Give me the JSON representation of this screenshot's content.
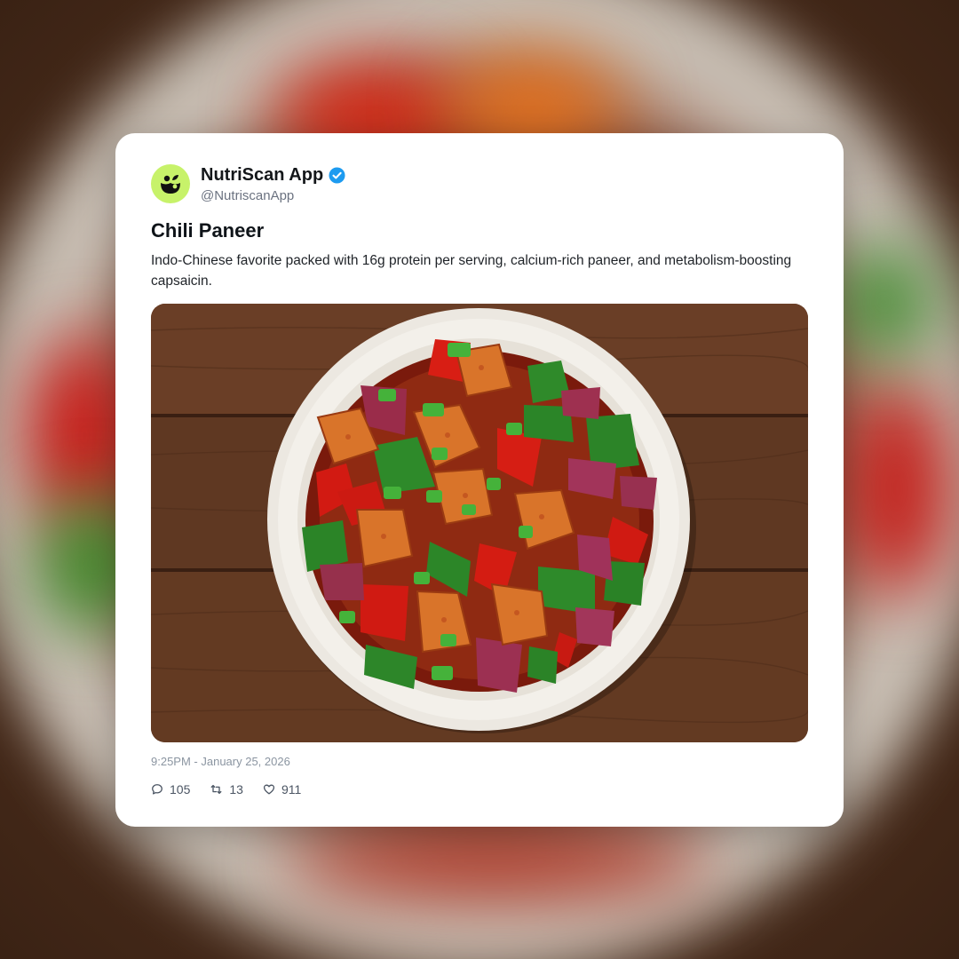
{
  "post": {
    "display_name": "NutriScan App",
    "handle": "@NutriscanApp",
    "verified_icon": "verified-badge-icon",
    "avatar_icon": "nutriscan-logo-icon",
    "title": "Chili Paneer",
    "body": "Indo-Chinese favorite packed with 16g protein per serving, calcium-rich paneer, and metabolism-boosting capsaicin.",
    "image_icon": "food-photo",
    "timestamp": "9:25PM - January 25, 2026",
    "stats": {
      "replies": "105",
      "reposts": "13",
      "likes": "911"
    },
    "stat_icons": [
      "comment-icon",
      "repost-icon",
      "heart-icon"
    ]
  },
  "colors": {
    "avatar_bg": "#c7f26a",
    "verified": "#1d9bf0",
    "card_bg": "#ffffff",
    "meta_text": "#8b95a1"
  }
}
